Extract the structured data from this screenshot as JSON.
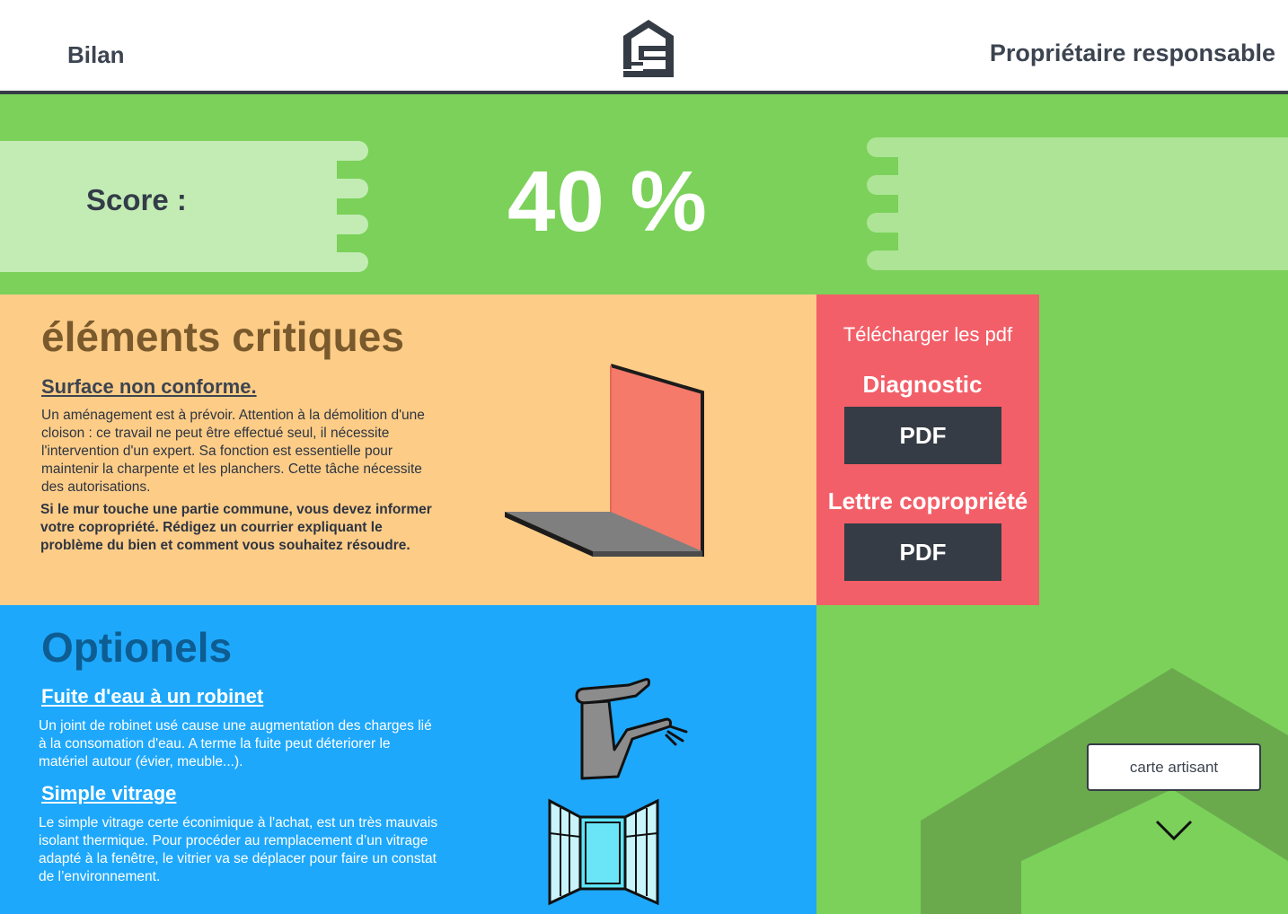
{
  "header": {
    "left_label": "Bilan",
    "right_label": "Propriétaire responsable",
    "logo_icon": "house-logo-icon"
  },
  "score": {
    "label": "Score :",
    "value": "40 %",
    "value_fraction": 0.4
  },
  "critical": {
    "title": "éléments critiques",
    "item_title": "Surface non conforme.",
    "description": " Un aménagement est à prévoir. Attention à la démolition d'une cloison : ce travail ne peut être effectué seul, il nécessite l'intervention d'un expert. Sa fonction est essentielle pour maintenir la charpente et les planchers. Cette tâche nécessite des autorisations.",
    "note": "Si le mur touche une partie commune, vous devez informer votre copropriété. Rédigez un courrier expliquant le problème du bien et comment vous souhaitez résoudre.",
    "illustration_icon": "wall-icon"
  },
  "download": {
    "title": "Télécharger les pdf",
    "diagnostic_label": "Diagnostic",
    "diagnostic_button": "PDF",
    "lettre_label": "Lettre copropriété",
    "lettre_button": "PDF"
  },
  "optional": {
    "title": "Optionels",
    "items": [
      {
        "title": "Fuite d'eau à un robinet",
        "description": "Un joint de robinet usé cause une augmentation des charges lié à la consomation d'eau. A terme la fuite peut déteriorer le matériel autour (évier, meuble...).",
        "icon": "faucet-icon"
      },
      {
        "title": "Simple vitrage",
        "description": "Le simple vitrage certe éconimique à l'achat, est un très mauvais isolant thermique.  Pour procéder au remplacement d’un vitrage adapté à la fenêtre, le vitrier va se déplacer pour faire un constat de l’environnement.",
        "icon": "window-icon"
      }
    ]
  },
  "sidebar": {
    "carte_button": "carte artisant",
    "scroll_icon": "chevron-down-icon"
  },
  "colors": {
    "header_border": "#353c45",
    "score_green": "#7bd15a",
    "critical_orange": "#fdcd88",
    "download_red": "#f35f68",
    "optional_blue": "#1ea8fb",
    "button_dark": "#353c45"
  }
}
